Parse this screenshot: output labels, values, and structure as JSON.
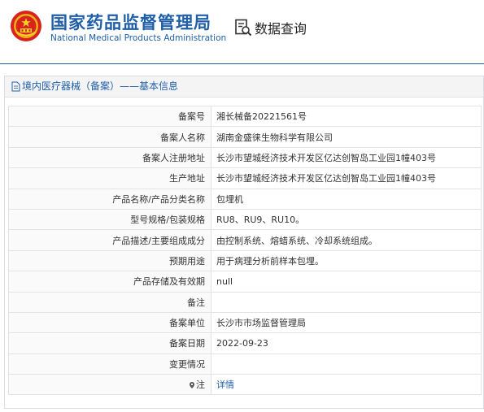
{
  "header": {
    "org_cn": "国家药品监督管理局",
    "org_en": "National Medical Products Administration",
    "query_label": "数据查询",
    "brand_color": "#1f5fa8",
    "emblem_color": "#d8241b"
  },
  "section": {
    "title": "境内医疗器械（备案）——基本信息"
  },
  "rows": [
    {
      "label": "备案号",
      "value": "湘长械备20221561号"
    },
    {
      "label": "备案人名称",
      "value": "湖南金盛徕生物科学有限公司"
    },
    {
      "label": "备案人注册地址",
      "value": "长沙市望城经济技术开发区亿达创智岛工业园1幢403号"
    },
    {
      "label": "生产地址",
      "value": "长沙市望城经济技术开发区亿达创智岛工业园1幢403号"
    },
    {
      "label": "产品名称/产品分类名称",
      "value": "包埋机"
    },
    {
      "label": "型号规格/包装规格",
      "value": "RU8、RU9、RU10。"
    },
    {
      "label": "产品描述/主要组成成分",
      "value": "由控制系统、熔蜡系统、冷却系统组成。"
    },
    {
      "label": "预期用途",
      "value": "用于病理分析前样本包埋。"
    },
    {
      "label": "产品存储及有效期",
      "value": "null"
    },
    {
      "label": "备注",
      "value": ""
    },
    {
      "label": "备案单位",
      "value": "长沙市市场监督管理局"
    },
    {
      "label": "备案日期",
      "value": "2022-09-23"
    },
    {
      "label": "变更情况",
      "value": ""
    },
    {
      "label": "注",
      "value": "详情"
    }
  ]
}
